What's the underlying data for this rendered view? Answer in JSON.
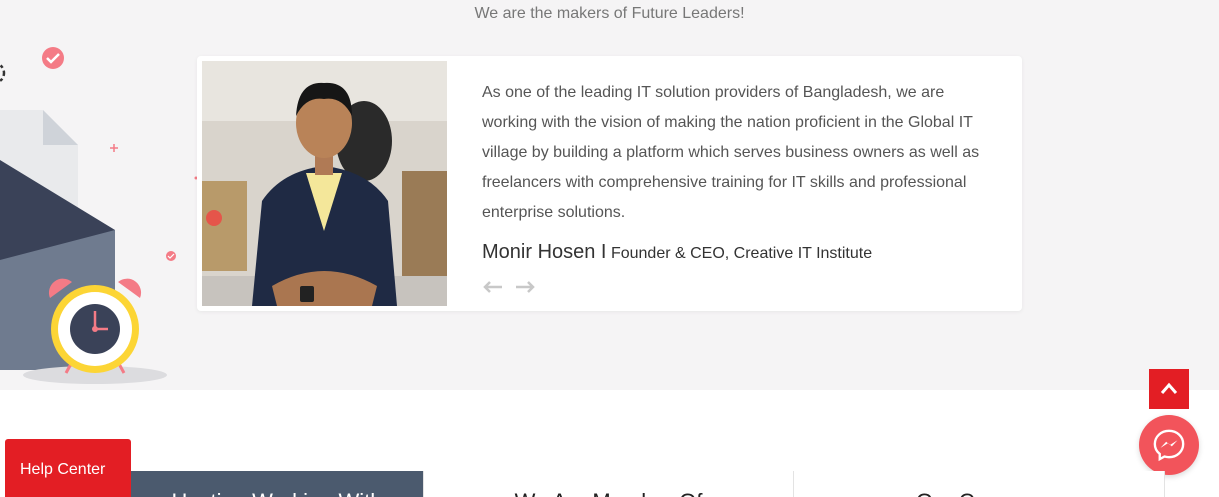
{
  "hero": {
    "tagline": "We are the makers of Future Leaders!"
  },
  "testimonial": {
    "quote": "As one of the leading IT solution providers of Bangladesh, we are working with the vision of making the nation proficient in the Global IT village by building a platform which serves business owners as well as freelancers with comprehensive training for IT skills and professional enterprise solutions.",
    "author_name": "Monir Hosen I",
    "author_role": "Founder & CEO, Creative IT Institute",
    "prev_icon": "arrow-left-icon",
    "next_icon": "arrow-right-icon"
  },
  "widgets": {
    "help_center_label": "Help Center",
    "back_to_top_icon": "chevron-up-icon",
    "messenger_icon": "messenger-icon"
  },
  "tabs": [
    {
      "label": "Hosting Working With"
    },
    {
      "label": "We Are Member Of"
    },
    {
      "label": "Our Concern"
    }
  ],
  "colors": {
    "accent_red": "#e31e24",
    "hero_bg": "#f5f4f5",
    "tab_active": "#4b5a6e",
    "messenger": "#f2545b"
  }
}
